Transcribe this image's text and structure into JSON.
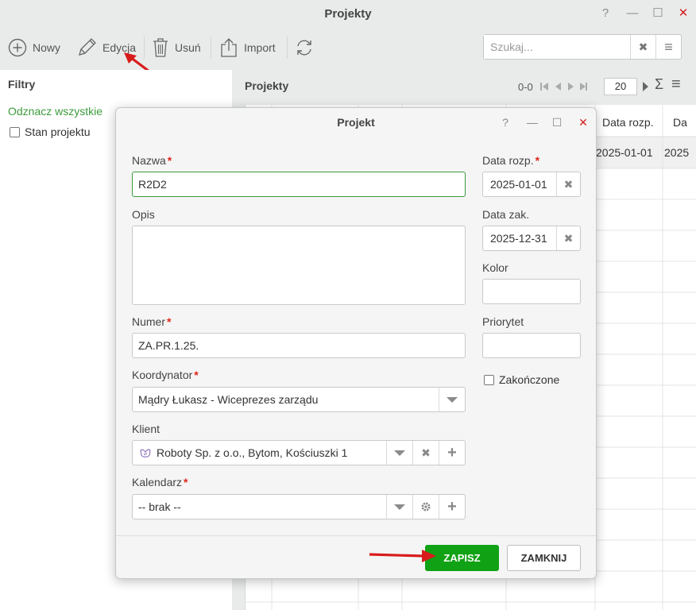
{
  "window": {
    "title": "Projekty",
    "help": "?",
    "minimize": "—",
    "maximize": "☐",
    "close": "✕"
  },
  "toolbar": {
    "new": "Nowy",
    "edit": "Edycja",
    "delete": "Usuń",
    "import": "Import"
  },
  "search": {
    "placeholder": "Szukaj...",
    "clear": "✖",
    "menu": "≡"
  },
  "filters": {
    "title": "Filtry",
    "uncheck_all": "Odznacz wszystkie",
    "state_label": "Stan projektu"
  },
  "list": {
    "title": "Projekty",
    "pager_range": "0-0",
    "page_size": "20",
    "columns": [
      "Data rozp.",
      "Da"
    ],
    "row": [
      "2025-01-01",
      "2025"
    ]
  },
  "dialog": {
    "title": "Projekt",
    "help": "?",
    "minimize": "—",
    "maximize": "☐",
    "close": "✕",
    "name_label": "Nazwa",
    "name_value": "R2D2",
    "desc_label": "Opis",
    "number_label": "Numer",
    "number_value": "ZA.PR.1.25.",
    "coordinator_label": "Koordynator",
    "coordinator_value": "Mądry Łukasz - Wiceprezes zarządu",
    "client_label": "Klient",
    "client_value": "Roboty Sp. z o.o., Bytom, Kościuszki 1",
    "calendar_label": "Kalendarz",
    "calendar_value": "-- brak --",
    "start_label": "Data rozp.",
    "start_value": "2025-01-01",
    "end_label": "Data zak.",
    "end_value": "2025-12-31",
    "color_label": "Kolor",
    "priority_label": "Priorytet",
    "finished_label": "Zakończone",
    "required_mark": "*",
    "save": "ZAPISZ",
    "close_btn": "ZAMKNIJ"
  },
  "colors": {
    "accent_green": "#10a214",
    "link_green": "#3b9b3b",
    "required": "#e0251b",
    "arrow": "#d81c1c"
  }
}
